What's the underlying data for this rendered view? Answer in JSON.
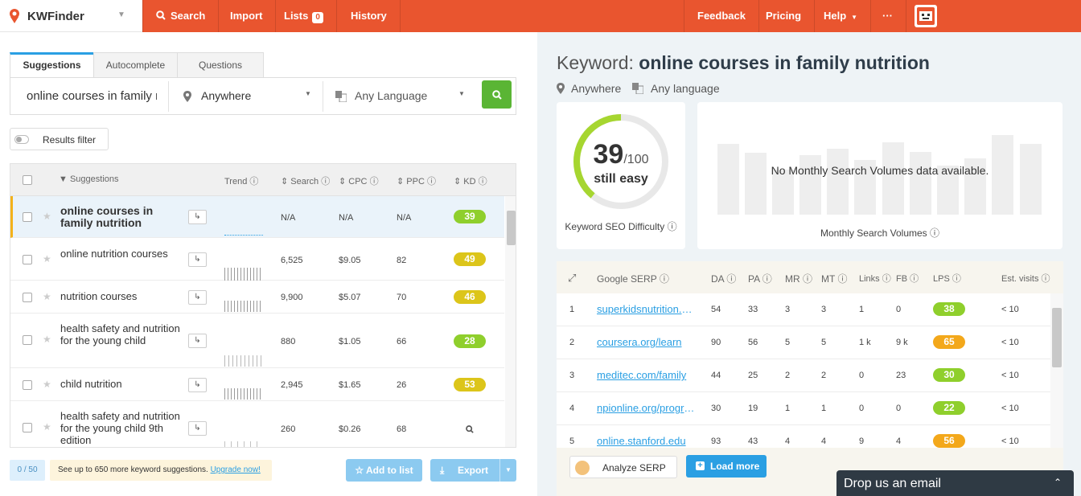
{
  "app": {
    "name": "KWFinder"
  },
  "nav": {
    "search": "Search",
    "import": "Import",
    "lists": "Lists",
    "lists_count": "0",
    "history": "History",
    "feedback": "Feedback",
    "pricing": "Pricing",
    "help": "Help",
    "more": "···"
  },
  "tabs": [
    "Suggestions",
    "Autocomplete",
    "Questions"
  ],
  "search": {
    "keyword": "online courses in family nutrition",
    "location": "Anywhere",
    "language": "Any Language"
  },
  "filter": {
    "label": "Results filter"
  },
  "table": {
    "headers": {
      "suggestions": "Suggestions",
      "trend": "Trend",
      "search": "Search",
      "cpc": "CPC",
      "ppc": "PPC",
      "kd": "KD"
    },
    "rows": [
      {
        "keyword": "online courses in family nutrition",
        "search": "N/A",
        "cpc": "N/A",
        "ppc": "N/A",
        "kd": "39",
        "kd_color": "#8fcf2c"
      },
      {
        "keyword": "online nutrition courses",
        "search": "6,525",
        "cpc": "$9.05",
        "ppc": "82",
        "kd": "49",
        "kd_color": "#dcc51a"
      },
      {
        "keyword": "nutrition courses",
        "search": "9,900",
        "cpc": "$5.07",
        "ppc": "70",
        "kd": "46",
        "kd_color": "#dcc51a"
      },
      {
        "keyword": "health safety and nutrition for the young child",
        "search": "880",
        "cpc": "$1.05",
        "ppc": "66",
        "kd": "28",
        "kd_color": "#8fcf2c"
      },
      {
        "keyword": "child nutrition",
        "search": "2,945",
        "cpc": "$1.65",
        "ppc": "26",
        "kd": "53",
        "kd_color": "#dcc51a"
      },
      {
        "keyword": "health safety and nutrition for the young child 9th edition",
        "search": "260",
        "cpc": "$0.26",
        "ppc": "68",
        "kd": "",
        "kd_color": ""
      }
    ]
  },
  "footer": {
    "counter": "0 / 50",
    "upsell_text": "See up to 650 more keyword suggestions.",
    "upsell_link": "Upgrade now!",
    "add_to_list": "Add to list",
    "export": "Export"
  },
  "detail": {
    "title_prefix": "Keyword:",
    "keyword": "online courses in family nutrition",
    "location": "Anywhere",
    "language": "Any language",
    "difficulty": {
      "score": "39",
      "max": "/100",
      "label": "still easy",
      "caption": "Keyword SEO Difficulty",
      "value": 39
    },
    "volume": {
      "message": "No Monthly Search Volumes data available.",
      "caption": "Monthly Search Volumes"
    }
  },
  "serp": {
    "headers": {
      "google_serp": "Google SERP",
      "da": "DA",
      "pa": "PA",
      "mr": "MR",
      "mt": "MT",
      "links": "Links",
      "fb": "FB",
      "lps": "LPS",
      "visits": "Est. visits"
    },
    "rows": [
      {
        "rank": "1",
        "url": "superkidsnutrition.com",
        "da": "54",
        "pa": "33",
        "mr": "3",
        "mt": "3",
        "links": "1",
        "fb": "0",
        "lps": "38",
        "lps_color": "#8fcf2c",
        "visits": "< 10"
      },
      {
        "rank": "2",
        "url": "coursera.org/learn",
        "da": "90",
        "pa": "56",
        "mr": "5",
        "mt": "5",
        "links": "1 k",
        "fb": "9 k",
        "lps": "65",
        "lps_color": "#f3a81b",
        "visits": "< 10"
      },
      {
        "rank": "3",
        "url": "meditec.com/family",
        "da": "44",
        "pa": "25",
        "mr": "2",
        "mt": "2",
        "links": "0",
        "fb": "23",
        "lps": "30",
        "lps_color": "#8fcf2c",
        "visits": "< 10"
      },
      {
        "rank": "4",
        "url": "npionline.org/programs",
        "da": "30",
        "pa": "19",
        "mr": "1",
        "mt": "1",
        "links": "0",
        "fb": "0",
        "lps": "22",
        "lps_color": "#8fcf2c",
        "visits": "< 10"
      },
      {
        "rank": "5",
        "url": "online.stanford.edu",
        "da": "93",
        "pa": "43",
        "mr": "4",
        "mt": "4",
        "links": "9",
        "fb": "4",
        "lps": "56",
        "lps_color": "#f3a81b",
        "visits": "< 10"
      }
    ],
    "analyze": "Analyze SERP",
    "load_more": "Load more"
  },
  "chat": {
    "label": "Drop us an email"
  },
  "colors": {
    "brand": "#e9552f",
    "accent": "#2a9fe3",
    "green": "#5ab534"
  }
}
